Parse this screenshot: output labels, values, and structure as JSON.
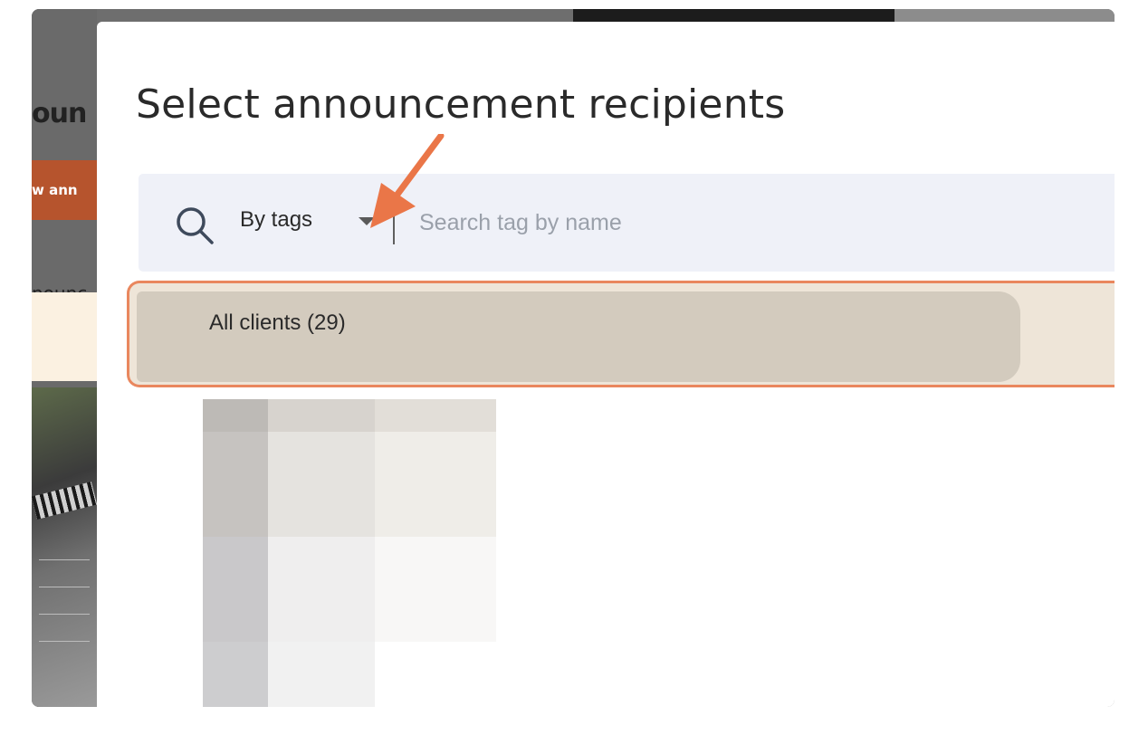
{
  "background_page": {
    "heading_fragment": "oun",
    "button_fragment": "w ann",
    "tab_fragment": "nounc"
  },
  "modal": {
    "title": "Select announcement recipients",
    "search": {
      "mode_label": "By tags",
      "placeholder": "Search tag by name",
      "value": ""
    },
    "list": {
      "items": [
        {
          "label": "All clients (29)",
          "selected": true
        }
      ]
    }
  },
  "colors": {
    "accent_orange": "#e9875e",
    "arrow": "#ea7648",
    "search_bar_bg": "#eff1f8",
    "selected_row_bg": "#d3cbbe"
  },
  "icons": {
    "search": "search-icon",
    "dropdown": "caret-down-icon",
    "callout": "arrow-callout-icon"
  }
}
